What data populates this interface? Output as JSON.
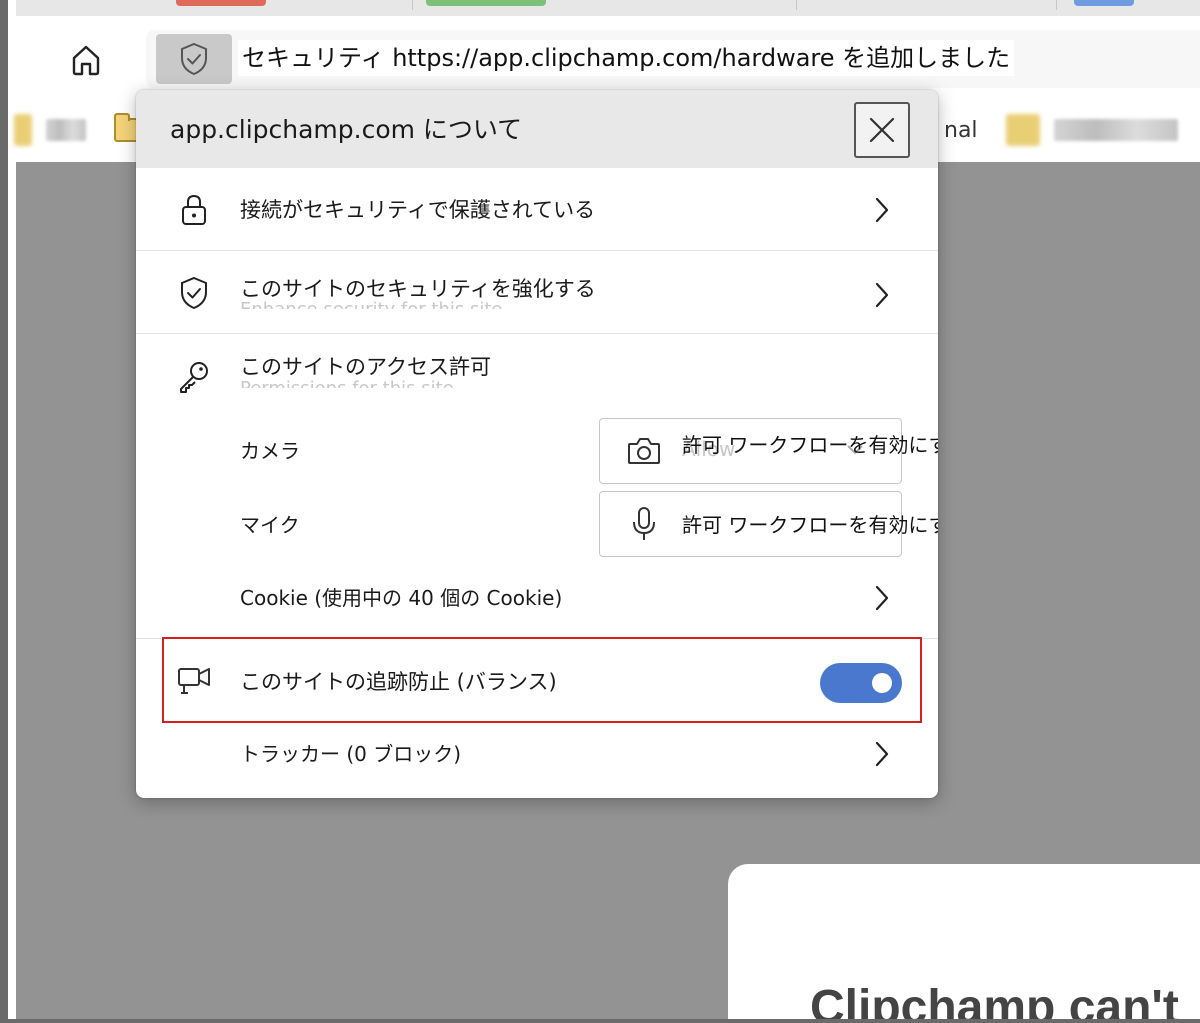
{
  "address_bar": {
    "text": "セキュリティ https://app.clipchamp.com/hardware を追加しました"
  },
  "favorites": {
    "partial_label": "nal"
  },
  "popup": {
    "title": "app.clipchamp.com について",
    "connection_label": "接続がセキュリティで保護されている",
    "enhance_security_label": "このサイトのセキュリティを強化する",
    "permissions_header": "このサイトのアクセス許可",
    "camera_label": "カメラ",
    "camera_value": "許可 ワークフローを有効にするオプション。",
    "mic_label": "マイク",
    "mic_value": "許可 ワークフローを有効にするオプション。",
    "cookie_label": "Cookie (使用中の 40 個の Cookie)",
    "tracking_label": "このサイトの追跡防止 (バランス)",
    "tracking_enabled": true,
    "trackers_label": "トラッカー (0 ブロック)"
  },
  "page": {
    "card_title": "Clipchamp can't"
  },
  "colors": {
    "toggle_on": "#4a78cf",
    "highlight_border": "#d62020",
    "page_dim": "#939393"
  }
}
